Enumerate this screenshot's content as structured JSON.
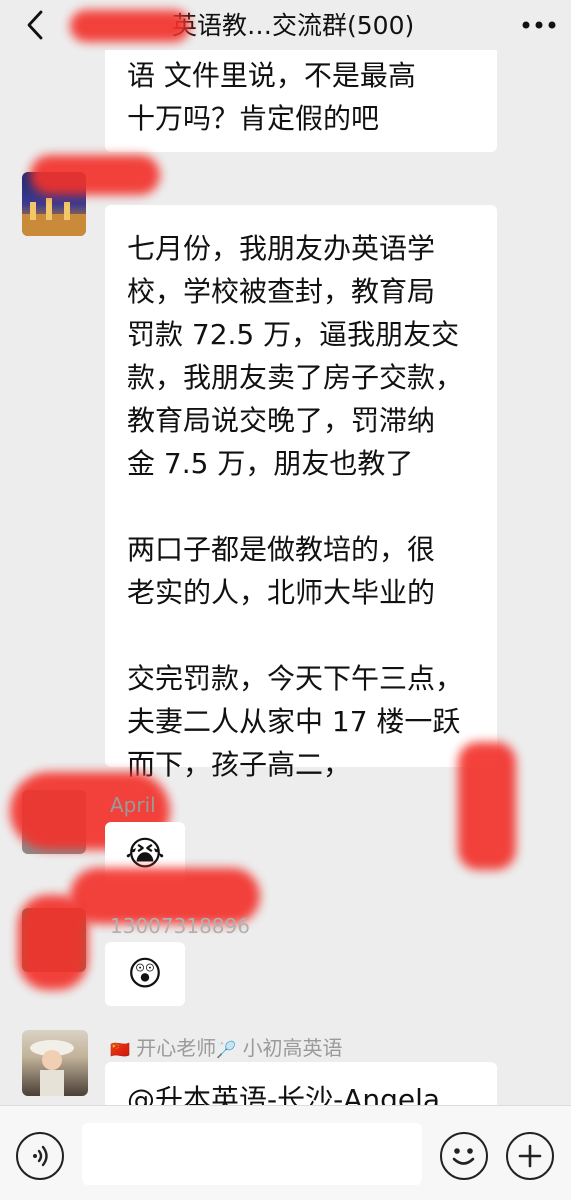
{
  "header": {
    "title": "英语教…交流群(500)",
    "back_icon": "chevron-left-icon",
    "more_icon": "more-icon"
  },
  "messages": [
    {
      "id": "m0",
      "text": "语  文件里说，不是最高\n十万吗？肯定假的吧"
    },
    {
      "id": "m1",
      "text": "七月份，我朋友办英语学\n校，学校被查封，教育局\n罚款 72.5 万，逼我朋友交\n款，我朋友卖了房子交款，\n教育局说交晚了，罚滞纳\n金 7.5 万，朋友也教了\n\n两口子都是做教培的，很\n老实的人，北师大毕业的\n\n交完罚款，今天下午三点，\n夫妻二人从家中 17 楼一跃\n而下，孩子高二，"
    },
    {
      "id": "m2",
      "sender": "April",
      "emoji": "😭",
      "emoji_name": "loudly-crying-emoji"
    },
    {
      "id": "m3",
      "sender": "13007318896",
      "emoji": "😲",
      "emoji_name": "astonished-emoji"
    },
    {
      "id": "m4",
      "sender_flag": "🇨🇳",
      "sender": "开心老师",
      "sender_emoji": "🏸",
      "sender_suffix": "小初高英语",
      "text": "@升本英语-长沙-Angela"
    }
  ],
  "input": {
    "placeholder": "",
    "value": ""
  },
  "colors": {
    "background": "#ededed",
    "bubble": "#ffffff",
    "redaction": "#f3322c"
  }
}
